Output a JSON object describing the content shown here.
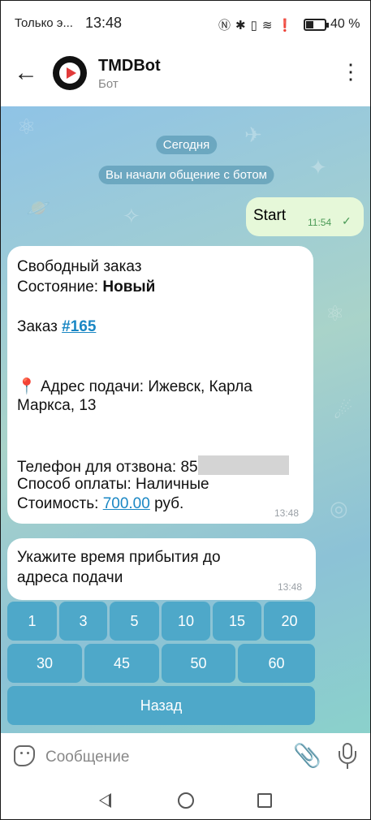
{
  "status_bar": {
    "carrier": "Только э...",
    "time": "13:48",
    "icons": [
      "nfc-icon",
      "bluetooth-icon",
      "vibrate-icon",
      "wifi-icon",
      "alert-icon"
    ],
    "battery": "40 %"
  },
  "header": {
    "title": "TMDBot",
    "subtitle": "Бот"
  },
  "chat": {
    "date_label": "Сегодня",
    "system_message": "Вы начали общение с ботом",
    "outgoing": {
      "text": "Start",
      "time": "11:54",
      "status_icon": "read-check-icon"
    },
    "order_message": {
      "line1": "Свободный заказ",
      "status_label": "Состояние: ",
      "status_value": "Новый",
      "order_label": "Заказ ",
      "order_link": "#165",
      "pin": "📍",
      "address_line1": " Адрес подачи: Ижевск, Карла",
      "address_line2": "Маркса, 13",
      "phone_label": "Телефон для отзвона: 85",
      "payment": "Способ оплаты: Наличные",
      "cost_label": "Стоимость: ",
      "cost_value": "700.00",
      "cost_unit": " руб.",
      "time": "13:48"
    },
    "prompt_message": {
      "line1": "Укажите время прибытия до",
      "line2": "адреса подачи",
      "time": "13:48"
    }
  },
  "keyboard": {
    "row1": [
      "1",
      "3",
      "5",
      "10",
      "15",
      "20"
    ],
    "row2": [
      "30",
      "45",
      "50",
      "60"
    ],
    "back": "Назад"
  },
  "input": {
    "placeholder": "Сообщение"
  },
  "colors": {
    "accent": "#1a87c4",
    "keyboard_button": "#4ea8c9",
    "outgoing_bubble": "#e6f8d9"
  }
}
